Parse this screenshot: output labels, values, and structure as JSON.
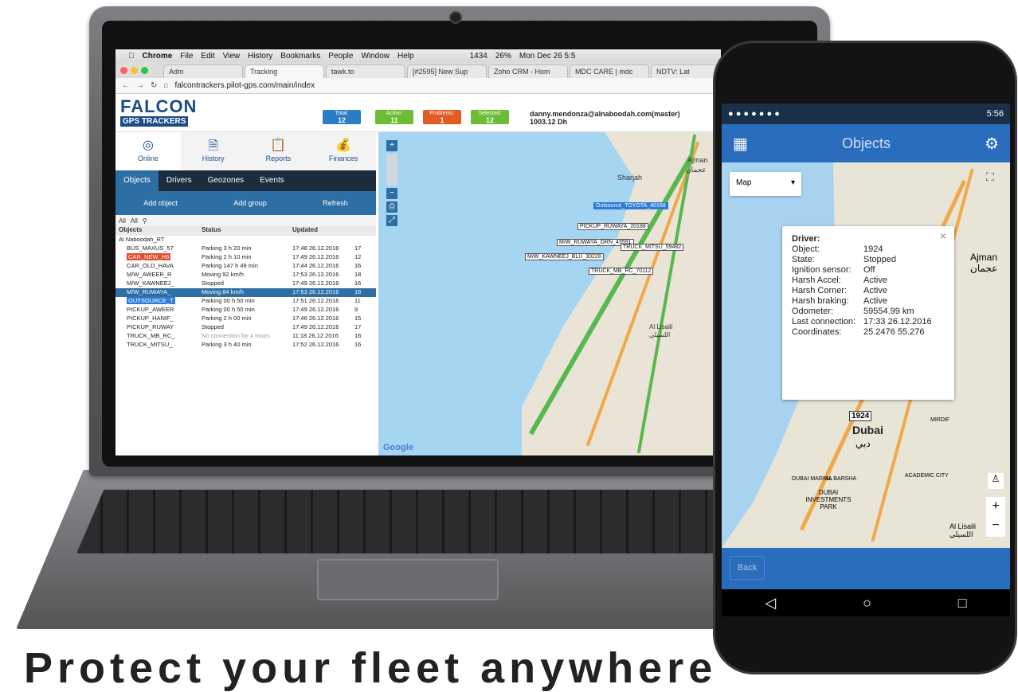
{
  "mac_menu": [
    "Chrome",
    "File",
    "Edit",
    "View",
    "History",
    "Bookmarks",
    "People",
    "Window",
    "Help"
  ],
  "mac_status": {
    "mail_count": "1434",
    "battery": "26%",
    "datetime": "Mon Dec 26 5:5"
  },
  "browser_tabs": [
    "Adm",
    "Tracking",
    "tawk.to",
    "[#2595] New Sup",
    "Zoho CRM - Hom",
    "MDC CARE | mdc",
    "NDTV: Lat"
  ],
  "url": "falcontrackers.pilot-gps.com/main/index",
  "brand": {
    "line1": "FALCON",
    "line2": "GPS TRACKERS"
  },
  "stats": [
    {
      "label": "Total:",
      "value": "12",
      "color": "#2a7ec4"
    },
    {
      "label": "Active:",
      "value": "11",
      "color": "#6cbd33"
    },
    {
      "label": "Problems:",
      "value": "1",
      "color": "#e45a20"
    },
    {
      "label": "Selected:",
      "value": "12",
      "color": "#6cbd33"
    }
  ],
  "user": {
    "email": "danny.mendonza@alnaboodah.com(master)",
    "balance": "1003.12 Dh"
  },
  "main_tabs": [
    "Online",
    "History",
    "Reports",
    "Finances"
  ],
  "sub_tabs": [
    "Objects",
    "Drivers",
    "Geozones",
    "Events"
  ],
  "actions": [
    "Add object",
    "Add group",
    "Refresh"
  ],
  "filters": [
    "All",
    "All"
  ],
  "table_headers": [
    "Objects",
    "Status",
    "Updated"
  ],
  "group": "Al Naboodah_RT",
  "rows": [
    {
      "name": "BUS_MAXUS_57",
      "status": "Parking 3 h 20 min",
      "updated": "17:48 26.12.2016",
      "sat": "17"
    },
    {
      "name": "CAR_NEW_H6",
      "status": "Parking 2 h 10 min",
      "updated": "17:49 26.12.2016",
      "sat": "12"
    },
    {
      "name": "CAR_OLD_HAVA",
      "status": "Parking 147 h 49 min",
      "updated": "17:44 26.12.2016",
      "sat": "16"
    },
    {
      "name": "M/W_AWEER_R",
      "status": "Moving 92 km/h",
      "updated": "17:53 26.12.2016",
      "sat": "18"
    },
    {
      "name": "M/W_KAWNEEJ_",
      "status": "Stopped",
      "updated": "17:49 26.12.2016",
      "sat": "16"
    },
    {
      "name": "M/W_RUWAYA_",
      "status": "Moving 84 km/h",
      "updated": "17:53 26.12.2016",
      "sat": "16"
    },
    {
      "name": "OUTSOURCE_T",
      "status": "Parking 00 h 50 min",
      "updated": "17:51 26.12.2016",
      "sat": "11"
    },
    {
      "name": "PICKUP_AWEER",
      "status": "Parking 00 h 50 min",
      "updated": "17:49 26.12.2016",
      "sat": "9"
    },
    {
      "name": "PICKUP_HANIF_",
      "status": "Parking 2 h 00 min",
      "updated": "17:46 26.12.2016",
      "sat": "15"
    },
    {
      "name": "PICKUP_RUWAY",
      "status": "Stopped",
      "updated": "17:49 26.12.2016",
      "sat": "17"
    },
    {
      "name": "TRUCK_MB_RC_",
      "status": "No connection for 4 hours",
      "updated": "11:18 26.12.2016",
      "sat": "16"
    },
    {
      "name": "TRUCK_MITSU_",
      "status": "Parking 3 h 40 min",
      "updated": "17:52 26.12.2016",
      "sat": "16"
    }
  ],
  "map_labels": [
    "Outsource_TOYOTA_40168",
    "PICKUP_RUWAYA_20188",
    "M/W_RUWAYA_GRN_43591",
    "TRUCK_MITSU_59482",
    "M/W_KAWNEEJ_BLU_30228",
    "TRUCK_MB_RC_70112"
  ],
  "map_places": [
    "Sharjah",
    "Ajman",
    "عجمان",
    "Al Lisaili",
    "اللسيلي",
    "Google"
  ],
  "phone": {
    "time": "5:56",
    "title": "Objects",
    "map_type": "Map",
    "popup": {
      "heading": "Driver:",
      "fields": [
        {
          "k": "Object:",
          "v": "1924"
        },
        {
          "k": "State:",
          "v": "Stopped"
        },
        {
          "k": "Ignition sensor:",
          "v": "Off"
        },
        {
          "k": "Harsh Accel:",
          "v": "Active"
        },
        {
          "k": "Harsh Corner:",
          "v": "Active"
        },
        {
          "k": "Harsh braking:",
          "v": "Active"
        },
        {
          "k": "Odometer:",
          "v": "59554.99 km"
        },
        {
          "k": "Last connection:",
          "v": "17:33 26.12.2016"
        },
        {
          "k": "Coordinates:",
          "v": "25.2476 55.276"
        }
      ]
    },
    "marker": "1924",
    "places": [
      "Dubai",
      "دبي",
      "Ajman",
      "عجمان",
      "Al Lisaili",
      "اللسيلي",
      "DUBAI INVESTMENTS PARK",
      "ACADEMIC CITY",
      "MIRDIF",
      "AL BARSHA",
      "DUBAI MARINA"
    ],
    "back": "Back"
  },
  "caption": "Protect your fleet anywhere"
}
